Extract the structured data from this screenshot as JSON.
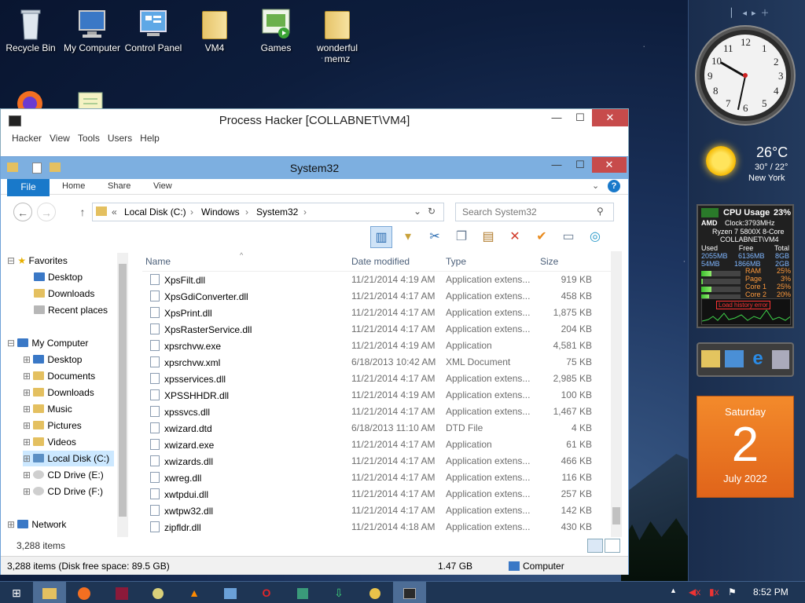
{
  "desktop": {
    "icons": [
      "Recycle Bin",
      "My Computer",
      "Control Panel",
      "VM4",
      "Games",
      "wonderful memz"
    ]
  },
  "process_hacker": {
    "title": "Process Hacker [COLLABNET\\VM4]",
    "menu": [
      "Hacker",
      "View",
      "Tools",
      "Users",
      "Help"
    ],
    "window_buttons": {
      "minimize": "—",
      "maximize": "☐",
      "close": "✕"
    }
  },
  "explorer": {
    "title": "System32",
    "window_buttons": {
      "minimize": "—",
      "maximize": "☐",
      "close": "✕"
    },
    "ribbon": {
      "file": "File",
      "tabs": [
        "Home",
        "Share",
        "View"
      ]
    },
    "address": {
      "prefix": "«",
      "crumbs": [
        "Local Disk (C:)",
        "Windows",
        "System32"
      ]
    },
    "search_placeholder": "Search System32",
    "tree": {
      "favorites": "Favorites",
      "fav_items": [
        "Desktop",
        "Downloads",
        "Recent places"
      ],
      "computer": "My Computer",
      "computer_items": [
        "Desktop",
        "Documents",
        "Downloads",
        "Music",
        "Pictures",
        "Videos",
        "Local Disk (C:)",
        "CD Drive (E:)",
        "CD Drive (F:)"
      ],
      "network": "Network"
    },
    "columns": [
      "Name",
      "Date modified",
      "Type",
      "Size"
    ],
    "files": [
      {
        "name": "XpsFilt.dll",
        "date": "11/21/2014 4:19 AM",
        "type": "Application extens...",
        "size": "919 KB"
      },
      {
        "name": "XpsGdiConverter.dll",
        "date": "11/21/2014 4:17 AM",
        "type": "Application extens...",
        "size": "458 KB"
      },
      {
        "name": "XpsPrint.dll",
        "date": "11/21/2014 4:17 AM",
        "type": "Application extens...",
        "size": "1,875 KB"
      },
      {
        "name": "XpsRasterService.dll",
        "date": "11/21/2014 4:17 AM",
        "type": "Application extens...",
        "size": "204 KB"
      },
      {
        "name": "xpsrchvw.exe",
        "date": "11/21/2014 4:19 AM",
        "type": "Application",
        "size": "4,581 KB"
      },
      {
        "name": "xpsrchvw.xml",
        "date": "6/18/2013 10:42 AM",
        "type": "XML Document",
        "size": "75 KB"
      },
      {
        "name": "xpsservices.dll",
        "date": "11/21/2014 4:17 AM",
        "type": "Application extens...",
        "size": "2,985 KB"
      },
      {
        "name": "XPSSHHDR.dll",
        "date": "11/21/2014 4:19 AM",
        "type": "Application extens...",
        "size": "100 KB"
      },
      {
        "name": "xpssvcs.dll",
        "date": "11/21/2014 4:17 AM",
        "type": "Application extens...",
        "size": "1,467 KB"
      },
      {
        "name": "xwizard.dtd",
        "date": "6/18/2013 11:10 AM",
        "type": "DTD File",
        "size": "4 KB"
      },
      {
        "name": "xwizard.exe",
        "date": "11/21/2014 4:17 AM",
        "type": "Application",
        "size": "61 KB"
      },
      {
        "name": "xwizards.dll",
        "date": "11/21/2014 4:17 AM",
        "type": "Application extens...",
        "size": "466 KB"
      },
      {
        "name": "xwreg.dll",
        "date": "11/21/2014 4:17 AM",
        "type": "Application extens...",
        "size": "116 KB"
      },
      {
        "name": "xwtpdui.dll",
        "date": "11/21/2014 4:17 AM",
        "type": "Application extens...",
        "size": "257 KB"
      },
      {
        "name": "xwtpw32.dll",
        "date": "11/21/2014 4:17 AM",
        "type": "Application extens...",
        "size": "142 KB"
      },
      {
        "name": "zipfldr.dll",
        "date": "11/21/2014 4:18 AM",
        "type": "Application extens...",
        "size": "430 KB"
      }
    ],
    "item_count": "3,288 items",
    "status": {
      "left": "3,288 items (Disk free space: 89.5 GB)",
      "size": "1.47 GB",
      "location": "Computer"
    }
  },
  "gadgets": {
    "weather": {
      "temp": "26°C",
      "range": "30° / 22°",
      "city": "New York"
    },
    "cpu": {
      "title": "CPU Usage",
      "usage": "23%",
      "vendor": "AMD",
      "clock": "Clock:3793MHz",
      "model": "Ryzen 7 5800X 8-Core",
      "host": "COLLABNET\\VM4",
      "hdr": [
        "Used",
        "Free",
        "Total"
      ],
      "mem": [
        "2055MB",
        "6136MB",
        "8GB"
      ],
      "page": [
        "54MB",
        "1866MB",
        "2GB"
      ],
      "stats": [
        {
          "label": "RAM",
          "value": "25%",
          "fill": 0.25
        },
        {
          "label": "Page",
          "value": "3%",
          "fill": 0.03
        },
        {
          "label": "Core 1",
          "value": "25%",
          "fill": 0.25
        },
        {
          "label": "Core 2",
          "value": "20%",
          "fill": 0.2
        }
      ],
      "warning": "Load history error"
    },
    "calendar": {
      "day": "Saturday",
      "date": "2",
      "month": "July 2022"
    }
  },
  "taskbar": {
    "time": "8:52 PM"
  }
}
